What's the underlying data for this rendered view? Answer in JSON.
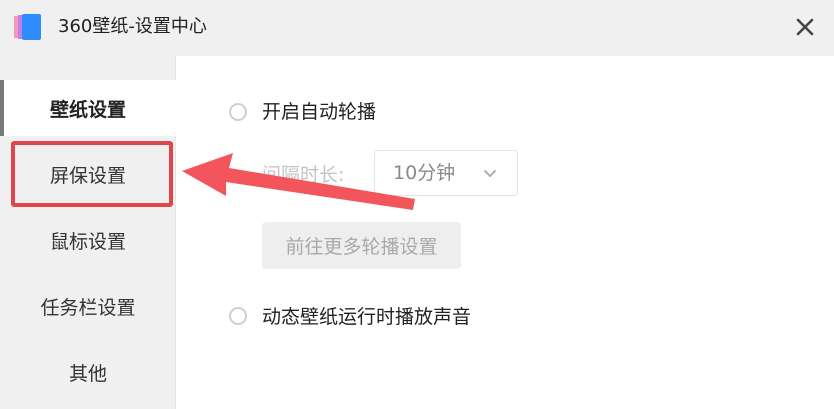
{
  "window": {
    "title": "360壁纸-设置中心",
    "logo_icon": "360-wallpaper-logo-icon",
    "close_icon": "close-icon"
  },
  "sidebar": {
    "items": [
      {
        "label": "壁纸设置",
        "active": true
      },
      {
        "label": "屏保设置",
        "active": false
      },
      {
        "label": "鼠标设置",
        "active": false
      },
      {
        "label": "任务栏设置",
        "active": false
      },
      {
        "label": "其他",
        "active": false
      }
    ]
  },
  "main": {
    "auto_rotate": {
      "label": "开启自动轮播",
      "checked": false
    },
    "interval": {
      "label": "间隔时长:",
      "value": "10分钟",
      "disabled": true
    },
    "more_settings_label": "前往更多轮播设置",
    "dynamic_sound": {
      "label": "动态壁纸运行时播放声音",
      "checked": false
    }
  },
  "annotation": {
    "highlight_color": "#e2454c",
    "arrow_color": "#f2565c"
  }
}
